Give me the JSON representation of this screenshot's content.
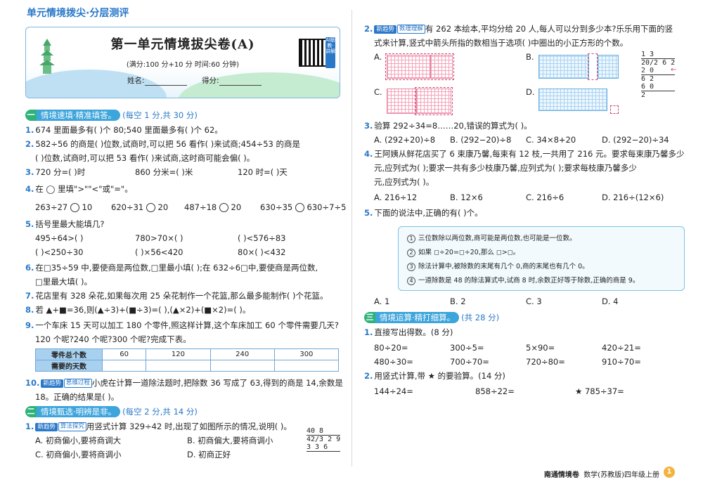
{
  "series": "单元情境拨尖·分层测评",
  "header": {
    "title": "第一单元情境拔尖卷(A)",
    "sub": "(满分:100 分+10 分  时间:60 分钟)",
    "name": "姓名:",
    "score": "得分:",
    "qr": "AI助教·讲解"
  },
  "s1": {
    "roman": "一",
    "label": "情境速填·精准填答。",
    "pts": "(每空 1 分,共 30 分)"
  },
  "q1": "674 里面最多有(    )个 80;540 里面最多有(    )个 62。",
  "q2a": "582÷56 的商是(    )位数,试商时,可以把 56 看作(    )来试商;454÷53 的商是",
  "q2b": "(    )位数,试商时,可以把 53 看作(    )来试商,这时商可能会偏(    )。",
  "q3": [
    "720 分=(    )时",
    "860 分米=(    )米",
    "120 时=(    )天"
  ],
  "q4": "在 ◯ 里填\">\"\"<\"或\"=\"。",
  "q4items": [
    "263÷27",
    "10",
    "620÷31",
    "20",
    "487÷18",
    "20",
    "630÷35",
    "630÷7÷5"
  ],
  "q5": "括号里最大能填几?",
  "q5r1": [
    "495÷64>(    )",
    "780>70×(    )",
    "(    )<576÷83"
  ],
  "q5r2": [
    "(    )<250÷30",
    "(    )×56<420",
    "80×(    )<432"
  ],
  "q6a": "在□35÷59 中,要使商是两位数,□里最小填(    );在 632÷6□中,要使商是两位数,",
  "q6b": "□里最大填(    )。",
  "q7": "花店里有 328 朵花,如果每次用 25 朵花制作一个花篮,那么最多能制作(    )个花篮。",
  "q8": "若 ▲+■=36,则(▲÷3)+(■÷3)=(    ),(▲×2)+(■×2)=(    )。",
  "q9a": "一个车床 15 天可以加工 180 个零件,照这样计算,这个车床加工 60 个零件需要几天?",
  "q9b": "120 个呢?240 个呢?300 个呢?完成下表。",
  "table": {
    "h1": "零件总个数",
    "h2": "需要的天数",
    "vals": [
      "60",
      "120",
      "240",
      "300"
    ]
  },
  "q10a": "小虎在计算一道除法题时,把除数 36 写成了 63,得到的商是 14,余数是",
  "q10b": "18。正确的结果是(    )。",
  "tags": {
    "new": "新趋势",
    "think": "思维过程",
    "algo": "算法探究",
    "math": "数理理解"
  },
  "s2": {
    "roman": "二",
    "label": "情境甄选·明辨是非。",
    "pts": "(每空 2 分,共 14 分)"
  },
  "s2q1": "用竖式计算 329÷42 时,出现了如图所示的情况,说明(    )。",
  "s2q1opts": [
    "A. 初商偏小,要将商调大",
    "B. 初商偏大,要将商调小",
    "C. 初商偏小,要将商调小",
    "D. 初商正好"
  ],
  "s2q1vert": [
    "40    8",
    "42/3 2 9",
    "  3 3 6"
  ],
  "s2q2a": "有 262 本绘本,平均分给 20 人,每人可以分到多少本?乐乐用下面的竖",
  "s2q2b": "式来计算,竖式中箭头所指的数相当于选项(    )中圈出的小正方形的个数。",
  "s2q2opts": [
    "A.",
    "B.",
    "C.",
    "D."
  ],
  "s2q2vert": [
    "   1 3",
    "20/2 6 2",
    "   2 0",
    "     6 2",
    "     6 0",
    "       2"
  ],
  "s2q3": "验算 292÷34=8……20,错误的算式为(    )。",
  "s2q3opts": [
    "A. (292+20)÷8",
    "B. (292−20)÷8",
    "C. 34×8+20",
    "D. (292−20)÷34"
  ],
  "s2q4a": "王阿姨从鲜花店买了 6 束康乃馨,每束有 12 枝,一共用了 216 元。要求每束康乃馨多少",
  "s2q4b": "元,应列式为(    );要求一共有多少枝康乃馨,应列式为(    );要求每枝康乃馨多少",
  "s2q4c": "元,应列式为(    )。",
  "s2q4opts": [
    "A. 216÷12",
    "B. 12×6",
    "C. 216÷6",
    "D. 216÷(12×6)"
  ],
  "s2q5": "下面的说法中,正确的有(    )个。",
  "s2q5st": [
    "三位数除以两位数,商可能是两位数,也可能是一位数。",
    "如果 ◻÷20=◻÷20,那么 ◻>◻。",
    "除法计算中,被除数的末尾有几个 0,商的末尾也有几个 0。",
    "一道除数是 48 的除法算式中,试商 8 时,余数正好等于除数,正确的商是 9。"
  ],
  "s2q5opts": [
    "A. 1",
    "B. 2",
    "C. 3",
    "D. 4"
  ],
  "s3": {
    "roman": "三",
    "label": "情境运算·精打细算。",
    "pts": "(共 28 分)"
  },
  "s3q1": "直接写出得数。(8 分)",
  "s3r1": [
    "80÷20=",
    "300÷5=",
    "5×90=",
    "420÷21="
  ],
  "s3r2": [
    "480÷30=",
    "700÷70=",
    "720÷80=",
    "910÷70="
  ],
  "s3q2": "用竖式计算,带 ★ 的要验算。(14 分)",
  "s3q2items": [
    "144÷24=",
    "858÷22=",
    "★ 785÷37="
  ],
  "footer": {
    "brand": "南通情境卷",
    "subject": "数学(苏教版)四年级上册",
    "page": "1"
  }
}
